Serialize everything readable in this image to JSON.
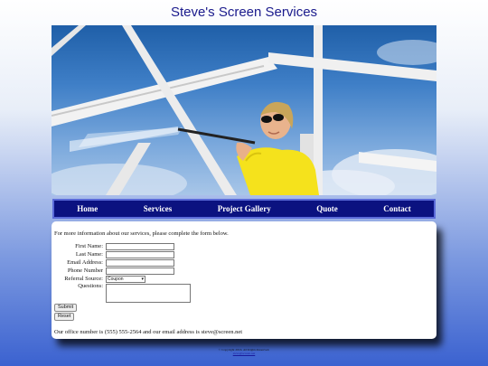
{
  "header": {
    "title": "Steve's Screen Services"
  },
  "nav": {
    "items": [
      {
        "label": "Home"
      },
      {
        "label": "Services"
      },
      {
        "label": "Project Gallery"
      },
      {
        "label": "Quote"
      },
      {
        "label": "Contact"
      }
    ]
  },
  "content": {
    "intro": "For more information about our services, please complete the form below.",
    "form": {
      "first_name_label": "First Name:",
      "last_name_label": "Last Name:",
      "email_label": "Email Address:",
      "phone_label": "Phone Number",
      "referral_label": "Referral Source:",
      "referral_value": "Coupon",
      "questions_label": "Questions:",
      "submit_label": "Submit",
      "reset_label": "Reset"
    },
    "office_text": "Our office number is (555) 555-2564 and our email address is steve@screen.net"
  },
  "footer": {
    "copyright": "© Copyright 2016. All Rights Reserved.",
    "link": "steve@screen.net"
  },
  "colors": {
    "nav_bg": "#0b1280",
    "title": "#1a1a8c"
  },
  "icons": {
    "hero": "pressure-washing-photo"
  }
}
